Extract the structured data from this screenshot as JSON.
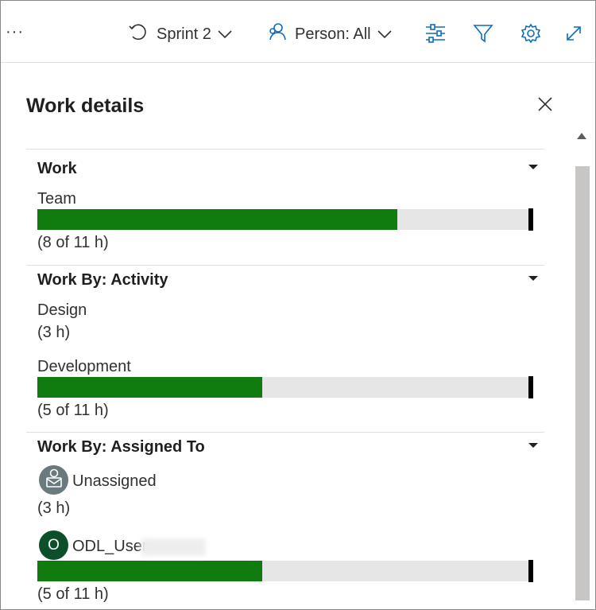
{
  "toolbar": {
    "more_label": "···",
    "sprint_label": "Sprint 2",
    "person_label": "Person: All",
    "icons": [
      "refresh-cycle-icon",
      "chevron-down-icon",
      "person-icon",
      "sliders-icon",
      "filter-icon",
      "gear-icon",
      "expand-icon"
    ],
    "accent": "#0f6cbd"
  },
  "panel": {
    "title": "Work details",
    "close_icon": "close-icon"
  },
  "sections": {
    "work": {
      "title": "Work",
      "team_label": "Team",
      "team_value": "(8 of 11 h)",
      "team_progress": 0.727
    },
    "activity": {
      "title": "Work By: Activity",
      "design_label": "Design",
      "design_value": "(3 h)",
      "development_label": "Development",
      "development_value": "(5 of 11 h)",
      "development_progress": 0.455
    },
    "assigned": {
      "title": "Work By: Assigned To",
      "unassigned_label": "Unassigned",
      "unassigned_value": "(3 h)",
      "user_initial": "O",
      "user_label": "ODL_User",
      "user_value": "(5 of 11 h)",
      "user_progress": 0.455
    }
  },
  "colors": {
    "progress_fill": "#107c10",
    "progress_track": "#e6e6e6",
    "avatar_user": "#0b4f2b",
    "avatar_unassigned": "#69797e"
  }
}
